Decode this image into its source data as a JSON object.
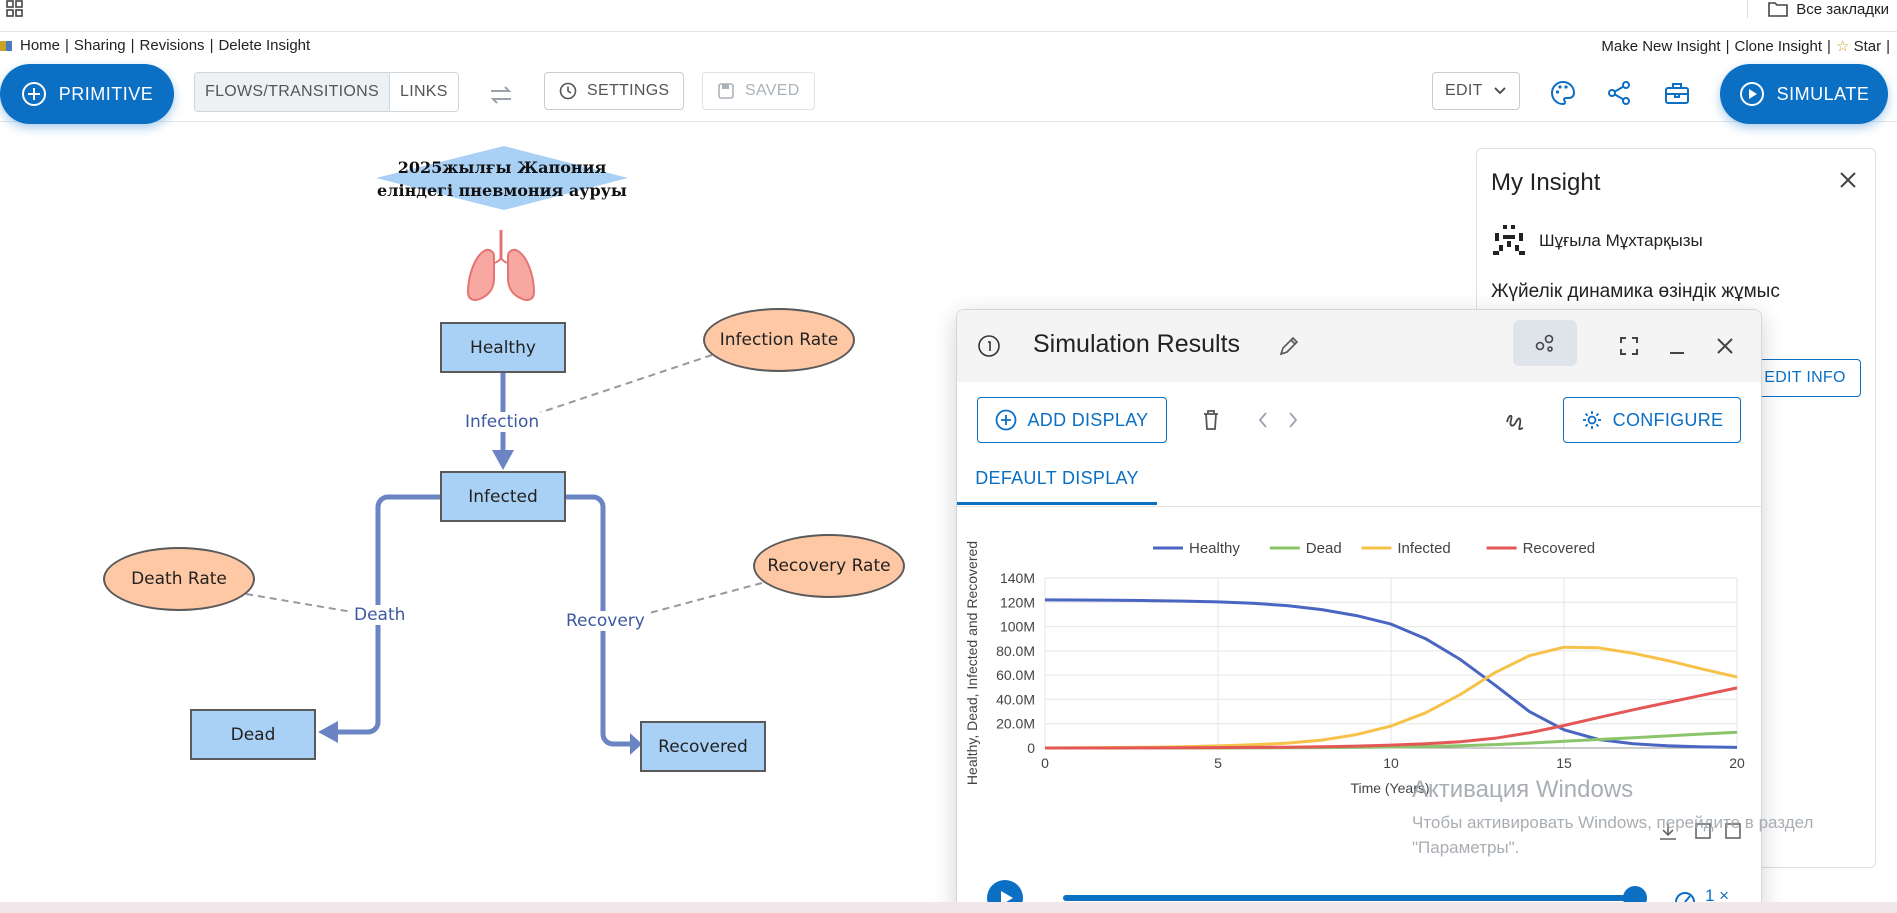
{
  "browser": {
    "all_bookmarks_label": "Все закладки"
  },
  "topnav": {
    "left": [
      "Home",
      "Sharing",
      "Revisions",
      "Delete Insight"
    ],
    "right_make_new": "Make New Insight",
    "right_clone": "Clone Insight",
    "right_star": "Star",
    "separator": "|"
  },
  "toolbar": {
    "primitive_label": "PRIMITIVE",
    "flows_transitions_label": "FLOWS/TRANSITIONS",
    "links_label": "LINKS",
    "settings_label": "SETTINGS",
    "saved_label": "SAVED",
    "edit_label": "EDIT",
    "simulate_label": "SIMULATE",
    "accent_color": "#0b6fc4"
  },
  "diagram": {
    "title_line1": "2025жылғы Жапония",
    "title_line2": "еліндегі пневмония ауруы",
    "stocks": {
      "healthy": "Healthy",
      "infected": "Infected",
      "dead": "Dead",
      "recovered": "Recovered"
    },
    "variables": {
      "infection_rate": "Infection Rate",
      "death_rate": "Death Rate",
      "recovery_rate": "Recovery Rate"
    },
    "flows": {
      "infection": "Infection",
      "death": "Death",
      "recovery": "Recovery"
    },
    "colors": {
      "stock_fill": "#a9d1f5",
      "variable_fill": "#fec8a4",
      "flow_line": "#6a84c4"
    }
  },
  "insight_panel": {
    "title": "My Insight",
    "author": "Шұғыла Мұхтарқызы",
    "description": "Жүйелік динамика өзіндік жұмыс",
    "edit_info_label": "EDIT INFO"
  },
  "simulation": {
    "window_title": "Simulation Results",
    "add_display_label": "ADD DISPLAY",
    "configure_label": "CONFIGURE",
    "tab_label": "DEFAULT DISPLAY",
    "speed_label": "1 ×",
    "progress": 1.0
  },
  "chart_data": {
    "type": "line",
    "xlabel": "Time (Years)",
    "ylabel": "Healthy, Dead, Infected and Recovered",
    "xlim": [
      0,
      20
    ],
    "ylim": [
      0,
      140000000
    ],
    "x_ticks": [
      0,
      5,
      10,
      15,
      20
    ],
    "y_ticks": [
      0,
      20000000,
      40000000,
      60000000,
      80000000,
      100000000,
      120000000,
      140000000
    ],
    "y_tick_labels": [
      "0",
      "20.0M",
      "40.0M",
      "60.0M",
      "80.0M",
      "100M",
      "120M",
      "140M"
    ],
    "legend_position": "top",
    "grid": true,
    "x": [
      0,
      1,
      2,
      3,
      4,
      5,
      6,
      7,
      8,
      9,
      10,
      11,
      12,
      13,
      14,
      15,
      16,
      17,
      18,
      19,
      20
    ],
    "series": [
      {
        "name": "Healthy",
        "color": "#4a66c2",
        "values": [
          122000000,
          121900000,
          121700000,
          121400000,
          121000000,
          120300000,
          119200000,
          117300000,
          114000000,
          109000000,
          102000000,
          90000000,
          73000000,
          52000000,
          30000000,
          15000000,
          7000000,
          3500000,
          1800000,
          900000,
          500000
        ]
      },
      {
        "name": "Dead",
        "color": "#8bc56b",
        "values": [
          0,
          0,
          0,
          0,
          0,
          0,
          100000,
          200000,
          300000,
          500000,
          800000,
          1200000,
          1800000,
          2800000,
          4000000,
          5500000,
          7000000,
          8500000,
          10000000,
          11500000,
          13000000
        ]
      },
      {
        "name": "Infected",
        "color": "#f7c24a",
        "values": [
          0,
          200000,
          400000,
          700000,
          1100000,
          1700000,
          2600000,
          4000000,
          6500000,
          11000000,
          18000000,
          29000000,
          44000000,
          62000000,
          76000000,
          83000000,
          82500000,
          78000000,
          72000000,
          65000000,
          58500000
        ]
      },
      {
        "name": "Recovered",
        "color": "#e45757",
        "values": [
          0,
          0,
          0,
          100000,
          200000,
          300000,
          500000,
          700000,
          1100000,
          1600000,
          2400000,
          3500000,
          5200000,
          8000000,
          12500000,
          18500000,
          25000000,
          31500000,
          37500000,
          43500000,
          49500000
        ]
      }
    ]
  },
  "watermark": {
    "title": "Активация Windows",
    "line1": "Чтобы активировать Windows, перейдите в раздел",
    "line2": "\"Параметры\"."
  }
}
